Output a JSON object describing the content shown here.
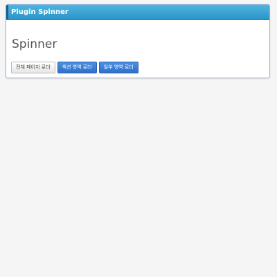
{
  "panel": {
    "header_title": "Plugin Spinner",
    "title": "Spinner"
  },
  "buttons": {
    "full_page_loader": "전체 페이지 로더",
    "section_area_loader": "섹션 영역 로더",
    "partial_area_loader": "일부 영역 로더"
  },
  "colors": {
    "header_gradient_top": "#4fb4e0",
    "header_gradient_bottom": "#2b95c9",
    "primary_button": "#3a7dd4",
    "page_background": "#f5f5f5"
  }
}
